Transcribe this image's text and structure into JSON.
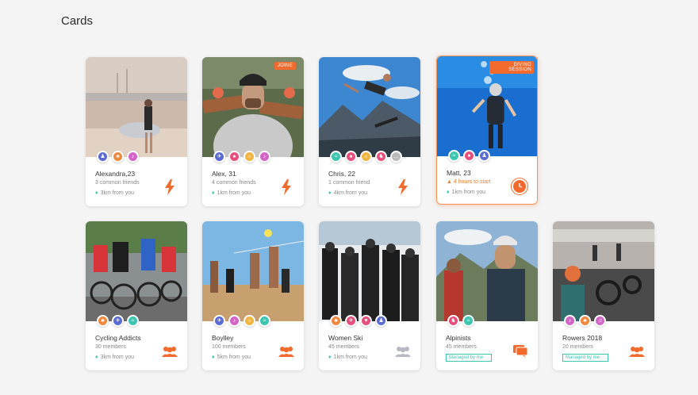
{
  "page_title": "Cards",
  "colors": {
    "accent": "#f26a2e",
    "teal": "#3cc6b0"
  },
  "row1": [
    {
      "name": "Alexandra,23",
      "sub": "3 common friends",
      "dist": "3km from you",
      "badge": "",
      "icons": [
        "#5b6bd6",
        "#f0883e",
        "#d266c6"
      ],
      "action": "bolt-icon"
    },
    {
      "name": "Alex, 31",
      "sub": "4 common friends",
      "dist": "1km from you",
      "badge": "JOINE",
      "icons": [
        "#5b6bd6",
        "#e94f7c",
        "#f0b440",
        "#d266c6"
      ],
      "action": "bolt-icon"
    },
    {
      "name": "Chris, 22",
      "sub": "1 common friend",
      "dist": "4km from you",
      "badge": "",
      "icons": [
        "#3cc6b0",
        "#e94f7c",
        "#f0b440",
        "#e94f7c",
        "#bbbbbb"
      ],
      "action": "bolt-icon"
    },
    {
      "name": "Matt, 23",
      "sub": "4 hours to start",
      "dist": "1km from you",
      "badge": "DIVING SESSION",
      "icons": [
        "#3cc6b0",
        "#e94f7c",
        "#5b6bd6"
      ],
      "action": "clock-icon"
    }
  ],
  "row2": [
    {
      "name": "Cycling Addicts",
      "sub": "30 members",
      "dist": "3km from you",
      "managed": "",
      "icons": [
        "#f0883e",
        "#5b6bd6",
        "#3cc6b0"
      ],
      "action": "group-icon"
    },
    {
      "name": "Boylley",
      "sub": "100 members",
      "dist": "5km from you",
      "managed": "",
      "icons": [
        "#5b6bd6",
        "#d266c6",
        "#f0b440",
        "#3cc6b0"
      ],
      "action": "group-icon"
    },
    {
      "name": "Women Ski",
      "sub": "45 members",
      "dist": "1km from you",
      "managed": "",
      "icons": [
        "#f0883e",
        "#e94f7c",
        "#e94f7c",
        "#5b6bd6"
      ],
      "action": "group-icon-grey"
    },
    {
      "name": "Alpinists",
      "sub": "45 members",
      "dist": "",
      "managed": "Managed by me",
      "icons": [
        "#e94f7c",
        "#3cc6b0"
      ],
      "action": "chat-icon"
    },
    {
      "name": "Rowers 2018",
      "sub": "20 members",
      "dist": "",
      "managed": "Managed by me",
      "icons": [
        "#d266c6",
        "#f0883e",
        "#d266c6"
      ],
      "action": "group-icon"
    }
  ]
}
